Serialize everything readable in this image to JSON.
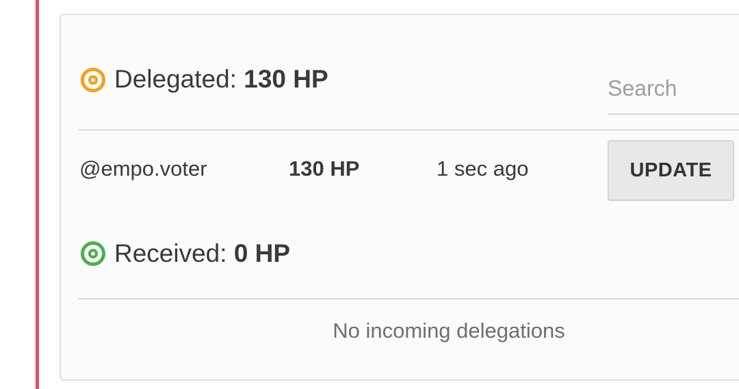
{
  "delegated": {
    "label": "Delegated: ",
    "amount": "130 HP",
    "icon": "target-ring-icon",
    "color": "#f59f1a"
  },
  "search": {
    "placeholder": "Search",
    "value": ""
  },
  "outgoing": [
    {
      "account": "@empo.voter",
      "amount": "130 HP",
      "time": "1 sec ago",
      "action_label": "UPDATE"
    }
  ],
  "received": {
    "label": "Received: ",
    "amount": "0 HP",
    "icon": "target-ring-icon",
    "color": "#4caf50"
  },
  "incoming": {
    "empty_message": "No incoming delegations"
  },
  "colors": {
    "accent_bar": "#d9506c",
    "panel_border": "#e0e0e0"
  }
}
